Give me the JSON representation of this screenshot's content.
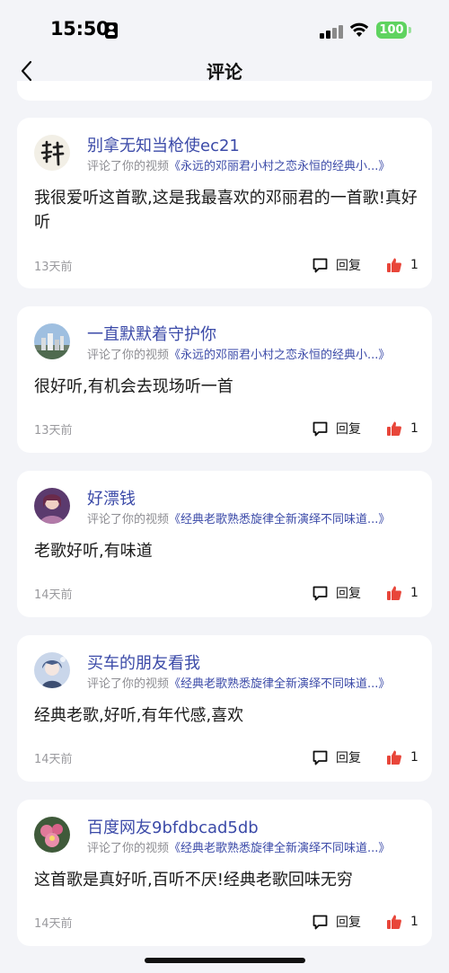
{
  "status_bar": {
    "time": "15:50",
    "battery": "100",
    "colors": {
      "battery": "#5fd360"
    }
  },
  "nav": {
    "title": "评论",
    "back_icon": "chevron-left-icon"
  },
  "colors": {
    "link": "#3b4aa8",
    "like": "#e8463a",
    "background": "#f3f4f8",
    "card": "#ffffff"
  },
  "comments": [
    {
      "username": "别拿无知当枪使ec21",
      "context_prefix": "评论了你的视频",
      "video_title": "《永远的邓丽君小村之恋永恒的经典小...》",
      "body": "我很爱听这首歌,这是我最喜欢的邓丽君的一首歌!真好听",
      "time": "13天前",
      "reply_label": "回复",
      "likes": "1",
      "avatar_icon": "calligraphy-avatar"
    },
    {
      "username": "一直默默着守护你",
      "context_prefix": "评论了你的视频",
      "video_title": "《永远的邓丽君小村之恋永恒的经典小...》",
      "body": "很好听,有机会去现场听一首",
      "time": "13天前",
      "reply_label": "回复",
      "likes": "1",
      "avatar_icon": "city-photo-avatar"
    },
    {
      "username": "好漂钱",
      "context_prefix": "评论了你的视频",
      "video_title": "《经典老歌熟悉旋律全新演绎不同味道...》",
      "body": "老歌好听,有味道",
      "time": "14天前",
      "reply_label": "回复",
      "likes": "1",
      "avatar_icon": "portrait-avatar"
    },
    {
      "username": "买车的朋友看我",
      "context_prefix": "评论了你的视频",
      "video_title": "《经典老歌熟悉旋律全新演绎不同味道...》",
      "body": "经典老歌,好听,有年代感,喜欢",
      "time": "14天前",
      "reply_label": "回复",
      "likes": "1",
      "avatar_icon": "anime-avatar"
    },
    {
      "username": "百度网友9bfdbcad5db",
      "context_prefix": "评论了你的视频",
      "video_title": "《经典老歌熟悉旋律全新演绎不同味道...》",
      "body": "这首歌是真好听,百听不厌!经典老歌回味无穷",
      "time": "14天前",
      "reply_label": "回复",
      "likes": "1",
      "avatar_icon": "flower-avatar"
    }
  ]
}
